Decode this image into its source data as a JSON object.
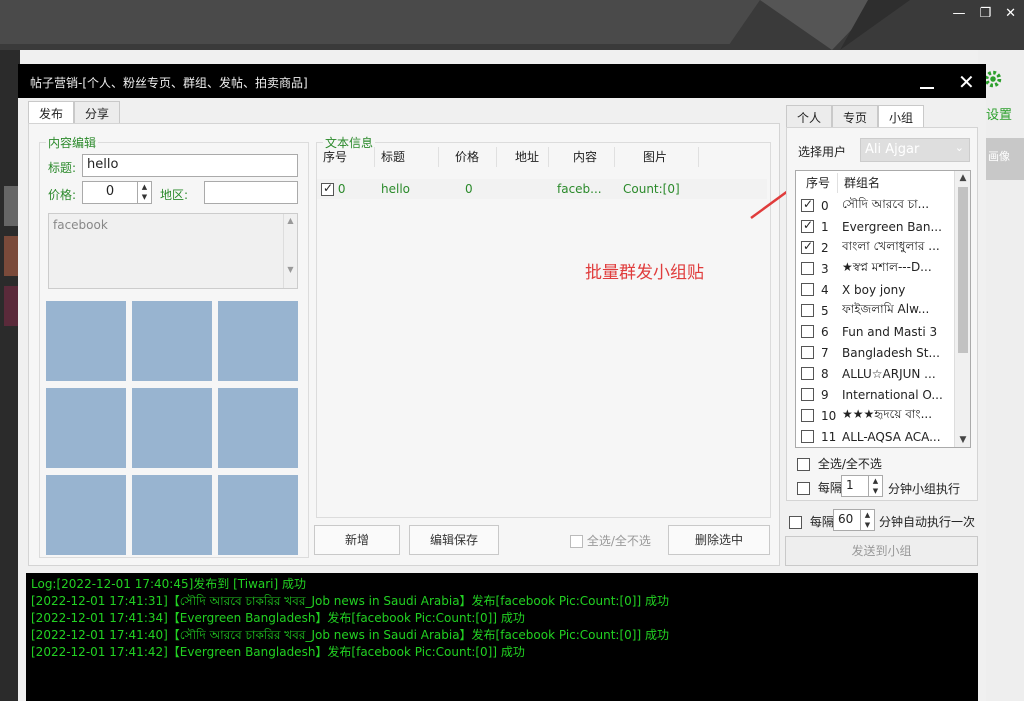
{
  "dialog": {
    "title": "帖子营销-[个人、粉丝专页、群组、发帖、拍卖商品]",
    "min_glyph": "",
    "close_glyph": "✕"
  },
  "background": {
    "settings_label": "设置",
    "side_label": "画像"
  },
  "left_tabs": [
    "发布",
    "分享"
  ],
  "content_edit": {
    "group_title": "内容编辑",
    "title_label": "标题:",
    "title_value": "hello",
    "price_label": "价格:",
    "price_value": "0",
    "region_label": "地区:",
    "region_value": "",
    "body_text": "facebook"
  },
  "text_info": {
    "group_title": "文本信息",
    "columns": [
      "序号",
      "标题",
      "价格",
      "地址",
      "内容",
      "图片"
    ],
    "rows": [
      {
        "checked": true,
        "index": "0",
        "title": "hello",
        "price": "0",
        "address": "",
        "content": "faceb...",
        "image": "Count:[0]"
      }
    ],
    "annotation": "批量群发小组贴"
  },
  "bottom_buttons": {
    "add": "新增",
    "edit_save": "编辑保存",
    "select_all": "全选/全不选",
    "delete_selected": "删除选中"
  },
  "right_tabs": [
    "个人",
    "专页",
    "小组"
  ],
  "groups_panel": {
    "user_label": "选择用户",
    "user_value": "Ali Ajgar",
    "col_index": "序号",
    "col_name": "群组名",
    "rows": [
      {
        "checked": true,
        "index": "0",
        "name": "সৌদি আরবে চা..."
      },
      {
        "checked": true,
        "index": "1",
        "name": "Evergreen Ban..."
      },
      {
        "checked": true,
        "index": "2",
        "name": "বাংলা খেলাধুলার ..."
      },
      {
        "checked": false,
        "index": "3",
        "name": "★স্বপ্ন মশাল---D..."
      },
      {
        "checked": false,
        "index": "4",
        "name": "X boy jony"
      },
      {
        "checked": false,
        "index": "5",
        "name": "ফাইজলামি Alw..."
      },
      {
        "checked": false,
        "index": "6",
        "name": "Fun and Masti 3"
      },
      {
        "checked": false,
        "index": "7",
        "name": "Bangladesh St..."
      },
      {
        "checked": false,
        "index": "8",
        "name": "ALLU☆ARJUN ..."
      },
      {
        "checked": false,
        "index": "9",
        "name": "International O..."
      },
      {
        "checked": false,
        "index": "10",
        "name": "★★★হৃদয়ে বাং..."
      },
      {
        "checked": false,
        "index": "11",
        "name": "ALL-AQSA ACA..."
      }
    ],
    "select_all": "全选/全不选",
    "every_label": "每隔",
    "every_value": "1",
    "every_suffix": "分钟小组执行",
    "auto_label": "每隔",
    "auto_value": "60",
    "auto_suffix": "分钟自动执行一次",
    "send_button": "发送到小组"
  },
  "log": [
    "Log:[2022-12-01 17:40:45]发布到 [Tiwari] 成功",
    "[2022-12-01 17:41:31]【সৌদি আরবে চাকরির খবর_Job news in Saudi Arabia】发布[facebook Pic:Count:[0]] 成功",
    "[2022-12-01 17:41:34]【Evergreen Bangladesh】发布[facebook Pic:Count:[0]] 成功",
    "[2022-12-01 17:41:40]【সৌদি আরবে চাকরির খবর_Job news in Saudi Arabia】发布[facebook Pic:Count:[0]] 成功",
    "[2022-12-01 17:41:42]【Evergreen Bangladesh】发布[facebook Pic:Count:[0]] 成功"
  ],
  "colors": {
    "accent_green": "#2b8a2b",
    "log_green": "#22d122",
    "annotation_red": "#e03c3c",
    "image_cell": "#98b4d0"
  }
}
